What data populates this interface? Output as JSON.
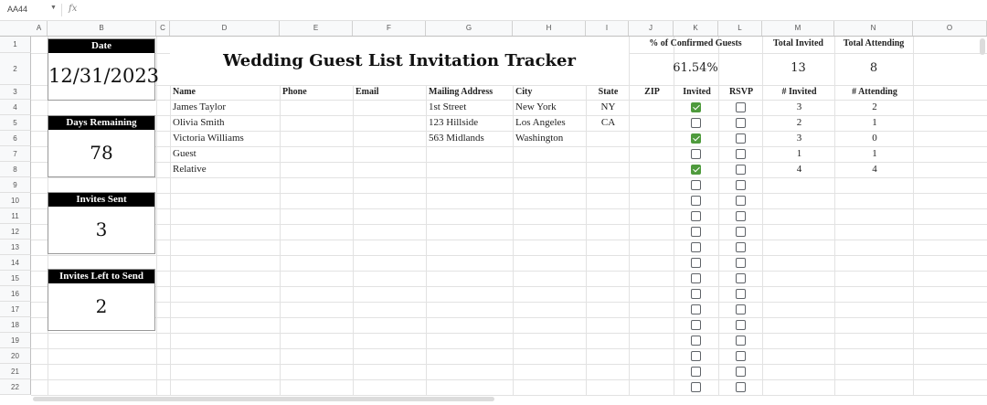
{
  "formula_bar": {
    "name_box": "AA44",
    "fx_label": "fx"
  },
  "columns": [
    "A",
    "B",
    "C",
    "D",
    "E",
    "F",
    "G",
    "H",
    "I",
    "J",
    "K",
    "L",
    "M",
    "N",
    "O"
  ],
  "rows": [
    "1",
    "2",
    "3",
    "4",
    "5",
    "6",
    "7",
    "8",
    "9",
    "10",
    "11",
    "12",
    "13",
    "14",
    "15",
    "16",
    "17",
    "18",
    "19",
    "20",
    "21",
    "22"
  ],
  "title": "Wedding Guest List Invitation Tracker",
  "cards": [
    {
      "label": "Date",
      "value": "12/31/2023"
    },
    {
      "label": "Days Remaining",
      "value": "78"
    },
    {
      "label": "Invites Sent",
      "value": "3"
    },
    {
      "label": "Invites Left to Send",
      "value": "2"
    }
  ],
  "summary": {
    "confirmed_label": "% of Confirmed Guests",
    "confirmed_value": "61.54%",
    "total_invited_label": "Total Invited",
    "total_invited_value": "13",
    "total_attending_label": "Total Attending",
    "total_attending_value": "8"
  },
  "table_headers": [
    "Name",
    "Phone",
    "Email",
    "Mailing Address",
    "City",
    "State",
    "ZIP",
    "Invited",
    "RSVP",
    "# Invited",
    "# Attending"
  ],
  "guests": [
    {
      "name": "James Taylor",
      "phone": "",
      "email": "",
      "address": "1st Street",
      "city": "New York",
      "state": "NY",
      "zip": "",
      "invited": true,
      "rsvp": false,
      "num_invited": "3",
      "num_attending": "2"
    },
    {
      "name": "Olivia Smith",
      "phone": "",
      "email": "",
      "address": "123 Hillside",
      "city": "Los Angeles",
      "state": "CA",
      "zip": "",
      "invited": false,
      "rsvp": false,
      "num_invited": "2",
      "num_attending": "1"
    },
    {
      "name": "Victoria Williams",
      "phone": "",
      "email": "",
      "address": "563 Midlands",
      "city": "Washington",
      "state": "",
      "zip": "",
      "invited": true,
      "rsvp": false,
      "num_invited": "3",
      "num_attending": "0"
    },
    {
      "name": "Guest",
      "phone": "",
      "email": "",
      "address": "",
      "city": "",
      "state": "",
      "zip": "",
      "invited": false,
      "rsvp": false,
      "num_invited": "1",
      "num_attending": "1"
    },
    {
      "name": "Relative",
      "phone": "",
      "email": "",
      "address": "",
      "city": "",
      "state": "",
      "zip": "",
      "invited": true,
      "rsvp": false,
      "num_invited": "4",
      "num_attending": "4"
    }
  ],
  "empty_checkbox_rows": 14
}
